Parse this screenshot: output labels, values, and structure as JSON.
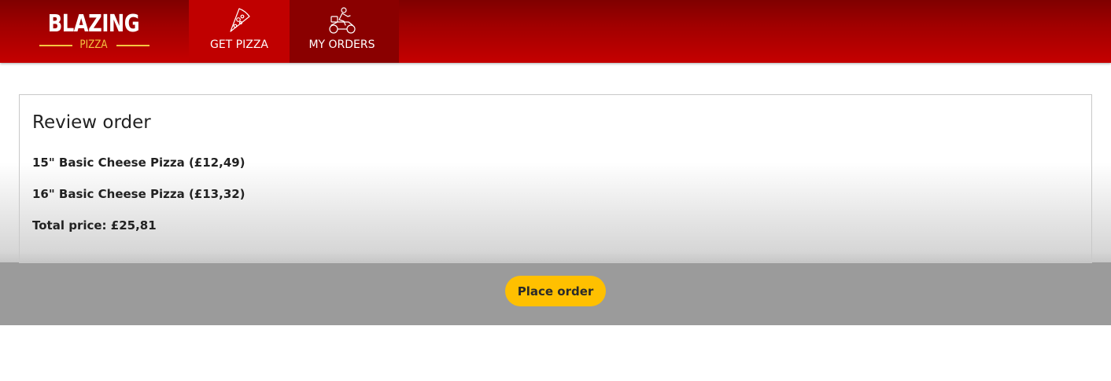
{
  "logo": {
    "word": "BLAZING",
    "sub": "PIZZA"
  },
  "nav": {
    "items": [
      {
        "label": "GET PIZZA",
        "icon": "pizza-slice-icon"
      },
      {
        "label": "MY ORDERS",
        "icon": "delivery-scooter-icon"
      }
    ]
  },
  "review": {
    "title": "Review order",
    "lines": [
      "15\" Basic Cheese Pizza (£12,49)",
      "16\" Basic Cheese Pizza (£13,32)"
    ],
    "total": "Total price: £25,81"
  },
  "actions": {
    "place_order": "Place order"
  },
  "colors": {
    "header_red": "#c00000",
    "header_dark": "#7f0000",
    "accent_yellow": "#ffc000",
    "logo_gold": "#f5c542"
  }
}
